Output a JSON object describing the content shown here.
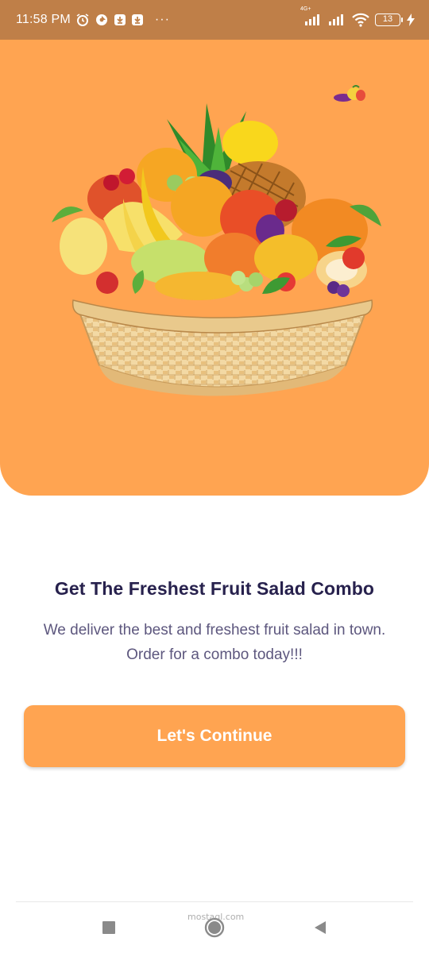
{
  "status_bar": {
    "time": "11:58 PM",
    "icons_left": [
      "alarm-icon",
      "app-notification-icon",
      "download-icon",
      "download-icon"
    ],
    "more": "···",
    "network_type": "4G+",
    "battery_level": "13",
    "icons_right": [
      "signal-icon",
      "signal-icon",
      "wifi-icon",
      "battery-icon",
      "charging-icon"
    ],
    "background_color": "#BF7F48"
  },
  "hero": {
    "background_color": "#FFA451",
    "image": "fruit-basket"
  },
  "welcome": {
    "headline": "Get The Freshest Fruit Salad Combo",
    "description": "We deliver the best and freshest fruit salad in town. Order for a combo today!!!"
  },
  "actions": {
    "continue_label": "Let's Continue",
    "button_color": "#FFA451"
  },
  "navigation_bar": {
    "buttons": [
      "recent-apps-icon",
      "home-icon",
      "back-icon"
    ]
  },
  "watermark": "mostaql.com"
}
